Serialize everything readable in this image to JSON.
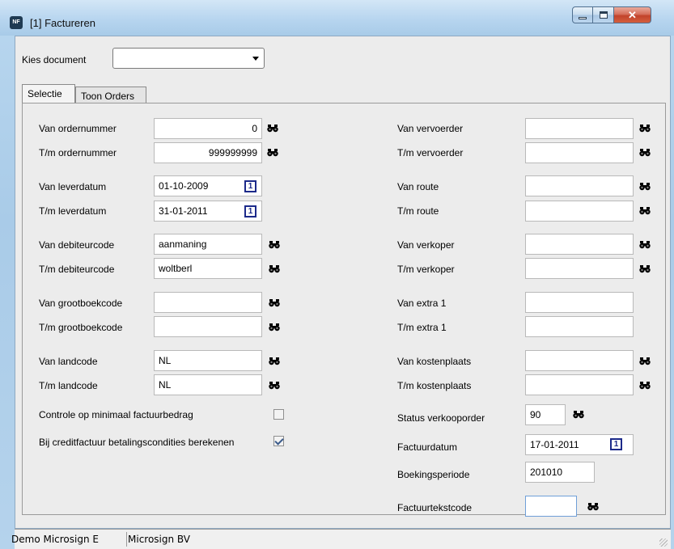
{
  "window": {
    "title": "[1]  Factureren",
    "icon": "app-icon"
  },
  "kies": {
    "label": "Kies document",
    "value": ""
  },
  "tabs": [
    {
      "label": "Selectie",
      "active": true
    },
    {
      "label": "Toon Orders",
      "active": false
    }
  ],
  "left": {
    "van_ordernummer": {
      "label": "Van ordernummer",
      "value": "0"
    },
    "tm_ordernummer": {
      "label": "T/m ordernummer",
      "value": "999999999"
    },
    "van_leverdatum": {
      "label": "Van leverdatum",
      "value": "01-10-2009"
    },
    "tm_leverdatum": {
      "label": "T/m leverdatum",
      "value": "31-01-2011"
    },
    "van_debiteurcode": {
      "label": "Van debiteurcode",
      "value": "aanmaning"
    },
    "tm_debiteurcode": {
      "label": "T/m debiteurcode",
      "value": "woltberl"
    },
    "van_grootboekcode": {
      "label": "Van grootboekcode",
      "value": ""
    },
    "tm_grootboekcode": {
      "label": "T/m grootboekcode",
      "value": ""
    },
    "van_landcode": {
      "label": "Van landcode",
      "value": "NL"
    },
    "tm_landcode": {
      "label": "T/m landcode",
      "value": "NL"
    },
    "controle": {
      "label": "Controle op minimaal factuurbedrag",
      "checked": false
    },
    "creditfactuur": {
      "label": "Bij creditfactuur betalingscondities berekenen",
      "checked": true
    }
  },
  "right": {
    "van_vervoerder": {
      "label": "Van vervoerder",
      "value": ""
    },
    "tm_vervoerder": {
      "label": "T/m vervoerder",
      "value": ""
    },
    "van_route": {
      "label": "Van route",
      "value": ""
    },
    "tm_route": {
      "label": "T/m route",
      "value": ""
    },
    "van_verkoper": {
      "label": "Van verkoper",
      "value": ""
    },
    "tm_verkoper": {
      "label": "T/m verkoper",
      "value": ""
    },
    "van_extra1": {
      "label": "Van extra 1",
      "value": ""
    },
    "tm_extra1": {
      "label": "T/m extra 1",
      "value": ""
    },
    "van_kostenplaats": {
      "label": "Van kostenplaats",
      "value": ""
    },
    "tm_kostenplaats": {
      "label": "T/m kostenplaats",
      "value": ""
    },
    "status_verkooporder": {
      "label": "Status verkooporder",
      "value": "90"
    },
    "factuurdatum": {
      "label": "Factuurdatum",
      "value": "17-01-2011"
    },
    "boekingsperiode": {
      "label": "Boekingsperiode",
      "value": "201010"
    },
    "factuurtekstcode": {
      "label": "Factuurtekstcode",
      "value": ""
    }
  },
  "statusbar": {
    "left": "Demo Microsign E",
    "right": "Microsign BV"
  },
  "icons": {
    "lookup": "binoculars-icon",
    "calendar": "calendar-icon"
  },
  "colors": {
    "title_bar": "#b7d5ef",
    "close_button": "#c2432b",
    "panel": "#ececec"
  }
}
